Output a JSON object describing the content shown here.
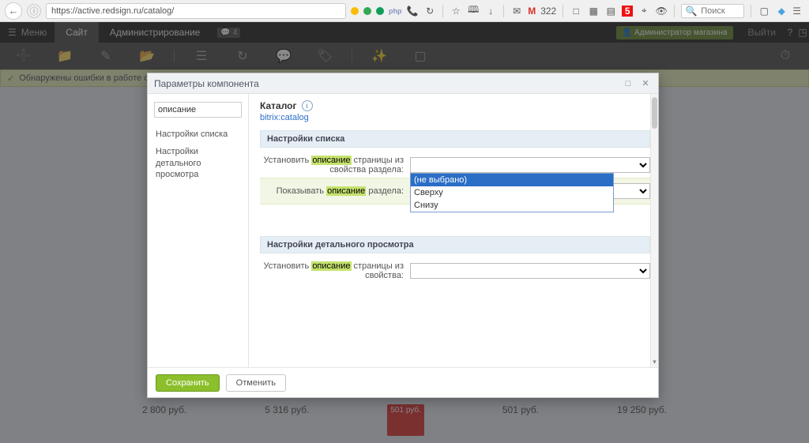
{
  "browser": {
    "url": "https://active.redsign.ru/catalog/",
    "gmail_count": "322",
    "search_placeholder": "Поиск"
  },
  "admin": {
    "menu_label": "Меню",
    "tab_site": "Сайт",
    "tab_admin": "Администрирование",
    "badge_count": "4",
    "user_label": "Администратор магазина",
    "exit_label": "Выйти"
  },
  "warning": {
    "text": "Обнаружены ошибки в работе сайта."
  },
  "modal": {
    "title": "Параметры компонента",
    "component_title": "Каталог",
    "component_code": "bitrix:catalog",
    "search_value": "описание",
    "tree": {
      "item1": "Настройки списка",
      "item2": "Настройки детального просмотра"
    },
    "sections": {
      "list_settings": "Настройки списка",
      "detail_settings": "Настройки детального просмотра"
    },
    "rows": {
      "set_from_section_property": {
        "pre": "Установить ",
        "hl": "описание",
        "post": " страницы из свойства раздела:"
      },
      "show_section_desc": {
        "pre": "Показывать ",
        "hl": "описание",
        "post": " раздела:",
        "value": "(не выбрано)"
      },
      "set_from_property": {
        "pre": "Установить ",
        "hl": "описание",
        "post": " страницы из свойства:"
      }
    },
    "dropdown_options": {
      "opt0": "(не выбрано)",
      "opt1": "Сверху",
      "opt2": "Снизу"
    },
    "buttons": {
      "save": "Сохранить",
      "cancel": "Отменить"
    }
  },
  "bg_prices": {
    "p1": "2 800 руб.",
    "p2": "5 316 руб.",
    "p3": "501 руб.",
    "p4": "501 руб.",
    "p5": "19 250 руб."
  }
}
